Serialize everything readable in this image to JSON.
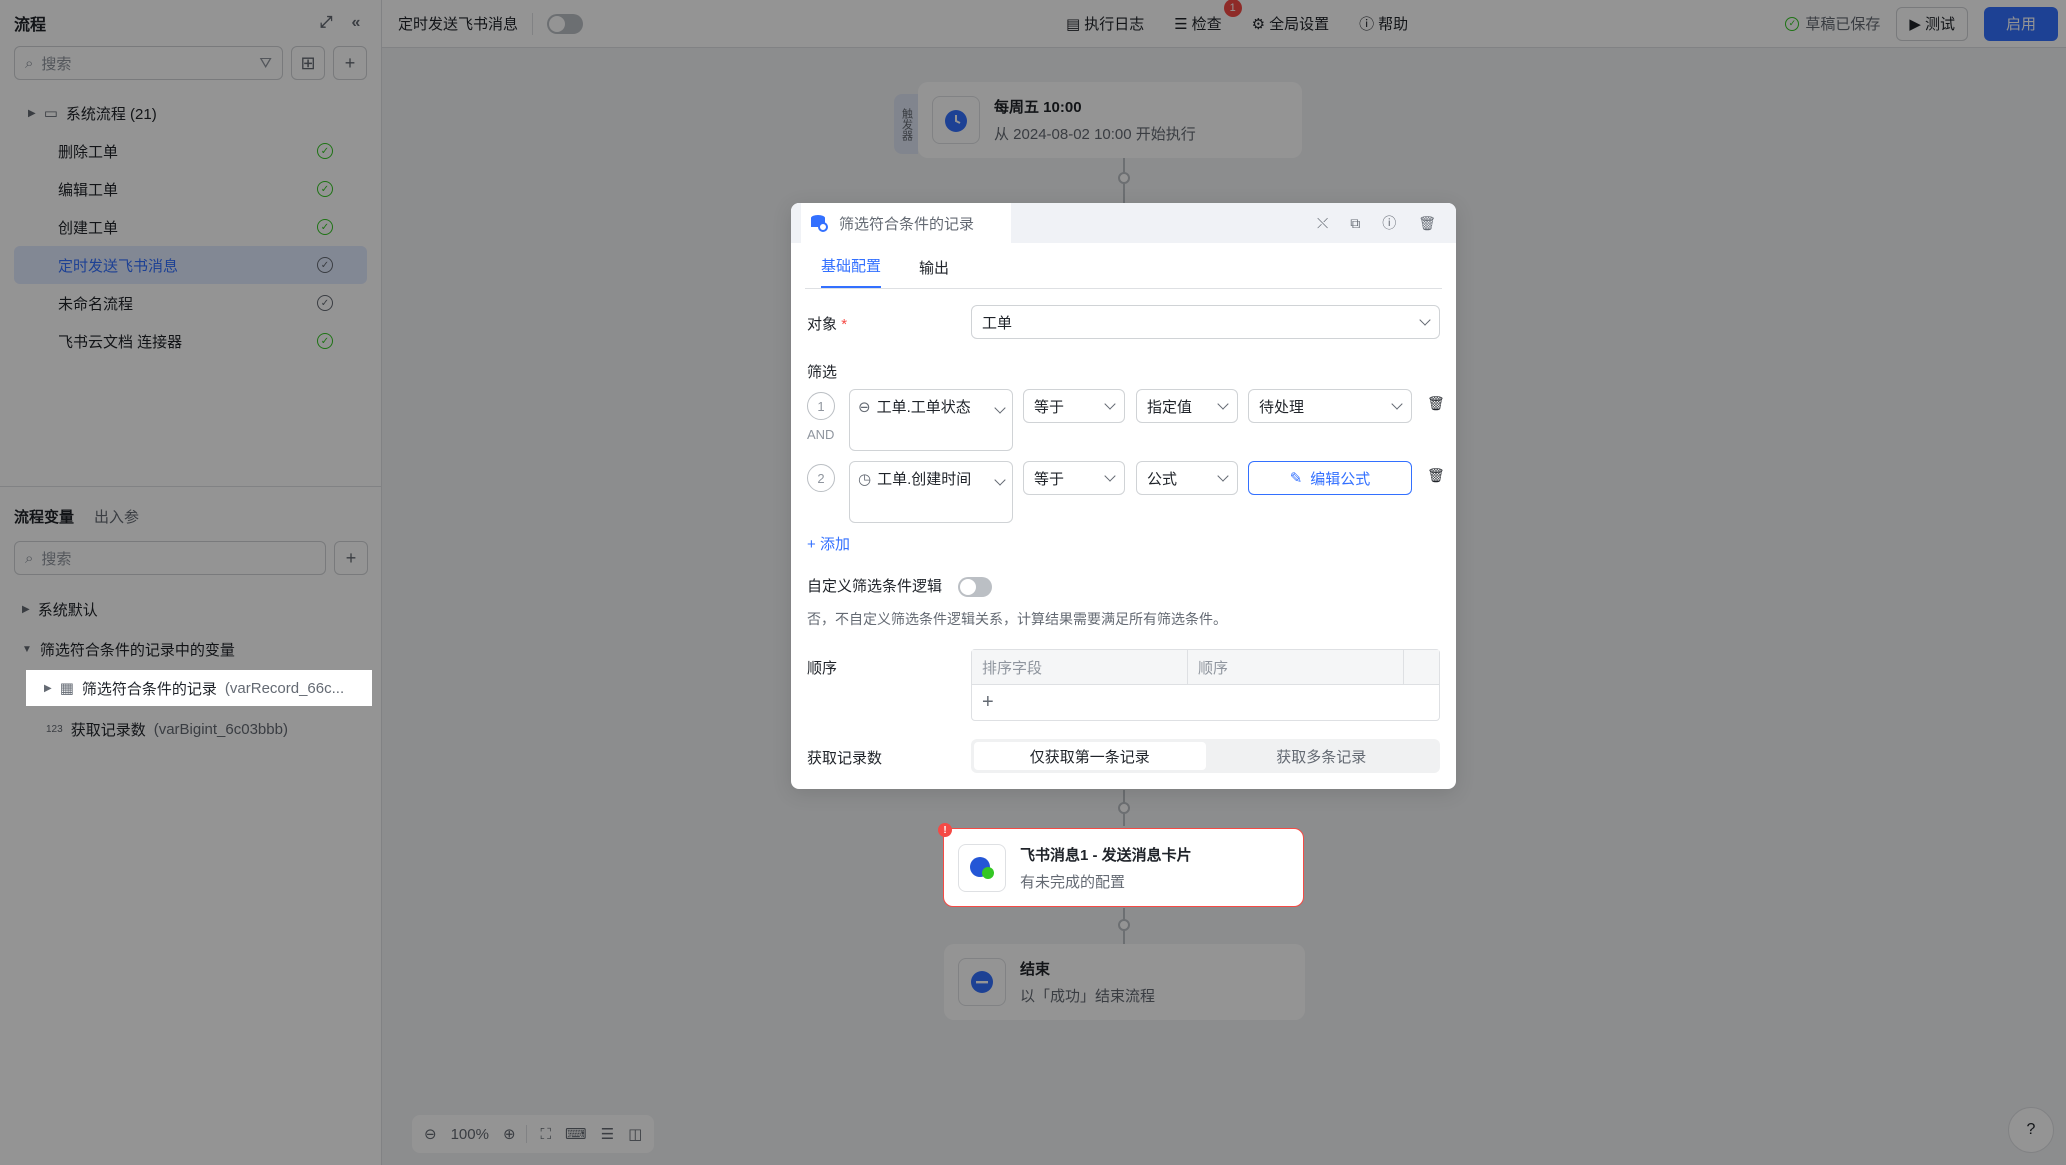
{
  "sidebar": {
    "title": "流程",
    "search_placeholder": "搜索",
    "group": {
      "label": "系统流程 (21)"
    },
    "items": [
      {
        "label": "删除工单"
      },
      {
        "label": "编辑工单"
      },
      {
        "label": "创建工单"
      },
      {
        "label": "定时发送飞书消息"
      },
      {
        "label": "未命名流程"
      },
      {
        "label": "飞书云文档 连接器"
      }
    ]
  },
  "vars": {
    "tab_vars": "流程变量",
    "tab_params": "出入参",
    "search_placeholder": "搜索",
    "system_default": "系统默认",
    "section": "筛选符合条件的记录中的变量",
    "record_var": {
      "name": "筛选符合条件的记录",
      "id": "(varRecord_66c..."
    },
    "count_var": {
      "prefix": "123",
      "name": "获取记录数",
      "id": "(varBigint_6c03bbb)"
    }
  },
  "topbar": {
    "title": "定时发送飞书消息",
    "exec_log": "执行日志",
    "check": "检查",
    "check_badge": "1",
    "global_settings": "全局设置",
    "help": "帮助",
    "saved": "草稿已保存",
    "test": "测试",
    "enable": "启用"
  },
  "trigger_node": {
    "tag": "触发器",
    "title": "每周五 10:00",
    "subtitle": "从 2024-08-02 10:00 开始执行"
  },
  "panel": {
    "title": "筛选符合条件的记录",
    "tab_basic": "基础配置",
    "tab_output": "输出",
    "object_label": "对象",
    "object_value": "工单",
    "filter_label": "筛选",
    "and_label": "AND",
    "conditions": [
      {
        "index": "1",
        "field": "工单.工单状态",
        "op": "等于",
        "type": "指定值",
        "value": "待处理"
      },
      {
        "index": "2",
        "field": "工单.创建时间",
        "op": "等于",
        "type": "公式",
        "value": "编辑公式"
      }
    ],
    "add": "添加",
    "custom_logic_label": "自定义筛选条件逻辑",
    "custom_logic_hint": "否，不自定义筛选条件逻辑关系，计算结果需要满足所有筛选条件。",
    "order_label": "顺序",
    "order_col_field": "排序字段",
    "order_col_order": "顺序",
    "count_label": "获取记录数",
    "count_opt_first": "仅获取第一条记录",
    "count_opt_multi": "获取多条记录"
  },
  "msg_node": {
    "title": "飞书消息1 - 发送消息卡片",
    "subtitle": "有未完成的配置"
  },
  "end_node": {
    "title": "结束",
    "subtitle": "以「成功」结束流程"
  },
  "zoom": {
    "level": "100%"
  },
  "colors": {
    "primary": "#3370ff",
    "success": "#34c724",
    "danger": "#f54a45"
  }
}
